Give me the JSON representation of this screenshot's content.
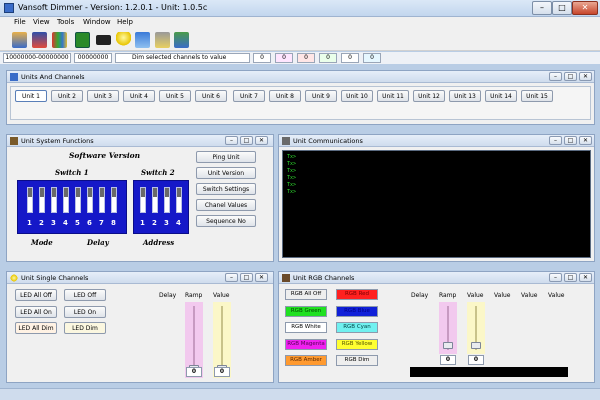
{
  "window": {
    "title": "Vansoft Dimmer - Version: 1.2.0.1 - Unit: 1.0.5c",
    "min": "–",
    "max": "□",
    "close": "✕"
  },
  "menu": [
    "File",
    "View",
    "Tools",
    "Window",
    "Help"
  ],
  "toolbar": {
    "icons": [
      "building-icon",
      "house-icon",
      "books-icon",
      "chip-icon",
      "module-icon",
      "lightbulb-icon",
      "swap-arrows-icon",
      "lamp-icon",
      "network-icon"
    ]
  },
  "status": {
    "range": "10000000-00000000",
    "value": "00000000",
    "message": "Dim selected channels to value",
    "fields": [
      "0",
      "0",
      "0",
      "0",
      "0",
      "0"
    ],
    "field_colors": [
      "#ffffff",
      "#ffe6ff",
      "#ffe6e6",
      "#eaffea",
      "#ffffff",
      "#e6f7ff"
    ]
  },
  "units_panel": {
    "title": "Units And Channels",
    "units": [
      "Unit 1",
      "Unit 2",
      "Unit 3",
      "Unit 4",
      "Unit 5",
      "Unit 6",
      "Unit 7",
      "Unit 8",
      "Unit 9",
      "Unit 10",
      "Unit 11",
      "Unit 12",
      "Unit 13",
      "Unit 14",
      "Unit 15"
    ],
    "selected": 0
  },
  "system_panel": {
    "title": "Unit System Functions",
    "software_version": "Software Version",
    "switch1": "Switch 1",
    "switch2": "Switch 2",
    "switch1_numbers": [
      "1",
      "2",
      "3",
      "4",
      "5",
      "6",
      "7",
      "8"
    ],
    "switch2_numbers": [
      "1",
      "2",
      "3",
      "4"
    ],
    "labels": {
      "mode": "Mode",
      "delay": "Delay",
      "address": "Address"
    },
    "buttons": [
      "Ping Unit",
      "Unit Version",
      "Switch Settings",
      "Chanel Values",
      "Sequence No"
    ]
  },
  "comms_panel": {
    "title": "Unit Communications",
    "lines": [
      "Tx>",
      "Tx>",
      "Tx>",
      "Tx>",
      "Tx>",
      "Tx>"
    ]
  },
  "single_panel": {
    "title": "Unit Single Channels",
    "buttons": [
      "LED All Off",
      "LED Off",
      "LED All On",
      "LED On",
      "LED All Dim",
      "LED Dim"
    ],
    "headers": {
      "delay": "Delay",
      "ramp": "Ramp",
      "value": "Value"
    },
    "ramp_value": "0",
    "value_value": "0",
    "ramp_color": "#f2c9ee",
    "value_color": "#fbf7c8"
  },
  "rgb_panel": {
    "title": "Unit RGB Channels",
    "buttons": [
      {
        "label": "RGB All Off",
        "bg": "#eeeeee",
        "fg": "#000000"
      },
      {
        "label": "RGB Red",
        "bg": "#ff2020",
        "fg": "#7a0000"
      },
      {
        "label": "RGB Green",
        "bg": "#20e020",
        "fg": "#004400"
      },
      {
        "label": "RGB Blue",
        "bg": "#1020d8",
        "fg": "#00008a"
      },
      {
        "label": "RGB White",
        "bg": "#ffffff",
        "fg": "#000000"
      },
      {
        "label": "RGB Cyan",
        "bg": "#70f0f0",
        "fg": "#004444"
      },
      {
        "label": "RGB Magenta",
        "bg": "#f020f0",
        "fg": "#550055"
      },
      {
        "label": "RGB Yellow",
        "bg": "#ffff30",
        "fg": "#555500"
      },
      {
        "label": "RGB Amber",
        "bg": "#ff9a30",
        "fg": "#5a2800"
      },
      {
        "label": "RGB Dim",
        "bg": "#eeeeee",
        "fg": "#000000"
      }
    ],
    "headers": [
      "Delay",
      "Ramp",
      "Value",
      "Value",
      "Value",
      "Value"
    ],
    "ramp_value": "0",
    "value_value": "0"
  }
}
